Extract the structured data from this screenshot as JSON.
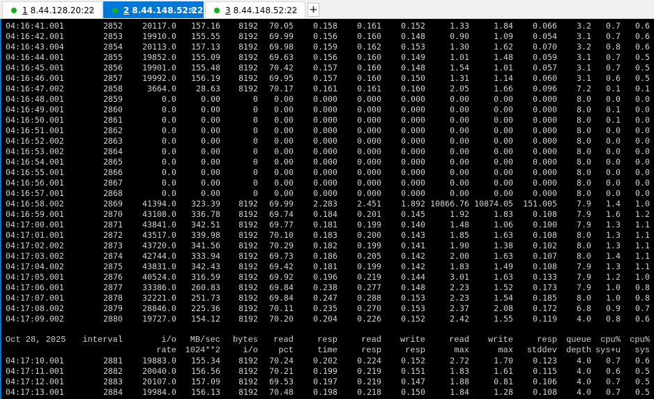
{
  "tabs": [
    {
      "num": "1",
      "label": "8.44.128.20:22",
      "active": false
    },
    {
      "num": "2",
      "label": "8.44.148.52:22",
      "active": true
    },
    {
      "num": "3",
      "label": "8.44.148.52:22",
      "active": false
    }
  ],
  "tab_close": "×",
  "new_tab": "+",
  "header": {
    "line1": [
      "Oct 28, 2025",
      "interval",
      "i/o",
      "MB/sec",
      "bytes",
      "read",
      "resp",
      "read",
      "write",
      "read",
      "write",
      "resp",
      "queue",
      "cpu%",
      "cpu%"
    ],
    "line2": [
      "",
      "",
      "rate",
      "1024**2",
      "i/o",
      "pct",
      "time",
      "resp",
      "resp",
      "max",
      "max",
      "stddev",
      "depth",
      "sys+u",
      "sys"
    ]
  },
  "rows_top": [
    [
      "04:16:41.001",
      "2852",
      "20117.0",
      "157.16",
      "8192",
      "70.05",
      "0.158",
      "0.161",
      "0.152",
      "1.33",
      "1.84",
      "0.066",
      "3.2",
      "0.7",
      "0.6"
    ],
    [
      "04:16:42.001",
      "2853",
      "19910.0",
      "155.55",
      "8192",
      "69.99",
      "0.156",
      "0.160",
      "0.148",
      "0.90",
      "1.09",
      "0.054",
      "3.1",
      "0.7",
      "0.6"
    ],
    [
      "04:16:43.004",
      "2854",
      "20113.0",
      "157.13",
      "8192",
      "69.98",
      "0.159",
      "0.162",
      "0.153",
      "1.30",
      "1.62",
      "0.070",
      "3.2",
      "0.8",
      "0.6"
    ],
    [
      "04:16:44.001",
      "2855",
      "19852.0",
      "155.09",
      "8192",
      "69.63",
      "0.156",
      "0.160",
      "0.149",
      "1.01",
      "1.48",
      "0.059",
      "3.1",
      "0.7",
      "0.5"
    ],
    [
      "04:16:45.001",
      "2856",
      "19901.0",
      "155.48",
      "8192",
      "70.42",
      "0.157",
      "0.160",
      "0.148",
      "1.54",
      "1.01",
      "0.057",
      "3.1",
      "0.7",
      "0.5"
    ],
    [
      "04:16:46.001",
      "2857",
      "19992.0",
      "156.19",
      "8192",
      "69.95",
      "0.157",
      "0.160",
      "0.150",
      "1.31",
      "1.14",
      "0.060",
      "3.1",
      "0.6",
      "0.5"
    ],
    [
      "04:16:47.002",
      "2858",
      "3664.0",
      "28.63",
      "8192",
      "70.17",
      "0.161",
      "0.161",
      "0.160",
      "2.05",
      "1.66",
      "0.096",
      "7.2",
      "0.1",
      "0.1"
    ],
    [
      "04:16:48.001",
      "2859",
      "0.0",
      "0.00",
      "0",
      "0.00",
      "0.000",
      "0.000",
      "0.000",
      "0.00",
      "0.00",
      "0.000",
      "8.0",
      "0.0",
      "0.0"
    ],
    [
      "04:16:49.001",
      "2860",
      "0.0",
      "0.00",
      "0",
      "0.00",
      "0.000",
      "0.000",
      "0.000",
      "0.00",
      "0.00",
      "0.000",
      "8.0",
      "0.1",
      "0.0"
    ],
    [
      "04:16:50.001",
      "2861",
      "0.0",
      "0.00",
      "0",
      "0.00",
      "0.000",
      "0.000",
      "0.000",
      "0.00",
      "0.00",
      "0.000",
      "8.0",
      "0.1",
      "0.0"
    ],
    [
      "04:16:51.001",
      "2862",
      "0.0",
      "0.00",
      "0",
      "0.00",
      "0.000",
      "0.000",
      "0.000",
      "0.00",
      "0.00",
      "0.000",
      "8.0",
      "0.0",
      "0.0"
    ],
    [
      "04:16:52.002",
      "2863",
      "0.0",
      "0.00",
      "0",
      "0.00",
      "0.000",
      "0.000",
      "0.000",
      "0.00",
      "0.00",
      "0.000",
      "8.0",
      "0.0",
      "0.0"
    ],
    [
      "04:16:53.002",
      "2864",
      "0.0",
      "0.00",
      "0",
      "0.00",
      "0.000",
      "0.000",
      "0.000",
      "0.00",
      "0.00",
      "0.000",
      "8.0",
      "0.0",
      "0.0"
    ],
    [
      "04:16:54.001",
      "2865",
      "0.0",
      "0.00",
      "0",
      "0.00",
      "0.000",
      "0.000",
      "0.000",
      "0.00",
      "0.00",
      "0.000",
      "8.0",
      "0.0",
      "0.0"
    ],
    [
      "04:16:55.001",
      "2866",
      "0.0",
      "0.00",
      "0",
      "0.00",
      "0.000",
      "0.000",
      "0.000",
      "0.00",
      "0.00",
      "0.000",
      "8.0",
      "0.0",
      "0.0"
    ],
    [
      "04:16:56.001",
      "2867",
      "0.0",
      "0.00",
      "0",
      "0.00",
      "0.000",
      "0.000",
      "0.000",
      "0.00",
      "0.00",
      "0.000",
      "8.0",
      "0.0",
      "0.0"
    ],
    [
      "04:16:57.001",
      "2868",
      "0.0",
      "0.00",
      "0",
      "0.00",
      "0.000",
      "0.000",
      "0.000",
      "0.00",
      "0.00",
      "0.000",
      "8.0",
      "0.0",
      "0.0"
    ],
    [
      "04:16:58.002",
      "2869",
      "41394.0",
      "323.39",
      "8192",
      "69.99",
      "2.283",
      "2.451",
      "1.892",
      "10866.76",
      "10874.05",
      "151.005",
      "7.9",
      "1.4",
      "1.0"
    ],
    [
      "04:16:59.001",
      "2870",
      "43108.0",
      "336.78",
      "8192",
      "69.74",
      "0.184",
      "0.201",
      "0.145",
      "1.92",
      "1.83",
      "0.108",
      "7.9",
      "1.6",
      "1.2"
    ],
    [
      "04:17:00.001",
      "2871",
      "43841.0",
      "342.51",
      "8192",
      "69.77",
      "0.181",
      "0.199",
      "0.140",
      "1.48",
      "1.06",
      "0.100",
      "7.9",
      "1.3",
      "1.1"
    ],
    [
      "04:17:01.001",
      "2872",
      "43517.0",
      "339.98",
      "8192",
      "70.10",
      "0.183",
      "0.200",
      "0.143",
      "1.85",
      "1.63",
      "0.108",
      "8.0",
      "1.3",
      "1.1"
    ],
    [
      "04:17:02.002",
      "2873",
      "43720.0",
      "341.56",
      "8192",
      "70.29",
      "0.182",
      "0.199",
      "0.141",
      "1.90",
      "1.38",
      "0.102",
      "8.0",
      "1.3",
      "1.1"
    ],
    [
      "04:17:03.002",
      "2874",
      "42744.0",
      "333.94",
      "8192",
      "69.73",
      "0.186",
      "0.205",
      "0.142",
      "2.00",
      "1.63",
      "0.107",
      "8.0",
      "1.4",
      "1.1"
    ],
    [
      "04:17:04.002",
      "2875",
      "43831.0",
      "342.43",
      "8192",
      "69.42",
      "0.181",
      "0.199",
      "0.142",
      "1.83",
      "1.49",
      "0.108",
      "7.9",
      "1.3",
      "1.1"
    ],
    [
      "04:17:05.001",
      "2876",
      "40524.0",
      "316.59",
      "8192",
      "69.92",
      "0.196",
      "0.219",
      "0.144",
      "3.01",
      "1.63",
      "0.133",
      "7.9",
      "1.2",
      "1.0"
    ],
    [
      "04:17:06.001",
      "2877",
      "33386.0",
      "260.83",
      "8192",
      "69.84",
      "0.238",
      "0.277",
      "0.148",
      "2.23",
      "1.52",
      "0.173",
      "7.9",
      "1.0",
      "0.8"
    ],
    [
      "04:17:07.001",
      "2878",
      "32221.0",
      "251.73",
      "8192",
      "69.84",
      "0.247",
      "0.288",
      "0.153",
      "2.23",
      "1.54",
      "0.185",
      "8.0",
      "1.0",
      "0.8"
    ],
    [
      "04:17:08.002",
      "2879",
      "28846.0",
      "225.36",
      "8192",
      "70.11",
      "0.235",
      "0.270",
      "0.153",
      "2.37",
      "2.08",
      "0.172",
      "6.8",
      "0.9",
      "0.7"
    ],
    [
      "04:17:09.002",
      "2880",
      "19727.0",
      "154.12",
      "8192",
      "70.20",
      "0.204",
      "0.226",
      "0.152",
      "2.42",
      "1.55",
      "0.119",
      "4.0",
      "0.8",
      "0.6"
    ]
  ],
  "rows_bottom": [
    [
      "04:17:10.001",
      "2881",
      "19883.0",
      "155.34",
      "8192",
      "70.24",
      "0.202",
      "0.224",
      "0.152",
      "2.72",
      "1.70",
      "0.123",
      "4.0",
      "0.7",
      "0.6"
    ],
    [
      "04:17:11.001",
      "2882",
      "20040.0",
      "156.56",
      "8192",
      "70.21",
      "0.199",
      "0.219",
      "0.151",
      "1.83",
      "1.61",
      "0.115",
      "4.0",
      "0.6",
      "0.5"
    ],
    [
      "04:17:12.001",
      "2883",
      "20107.0",
      "157.09",
      "8192",
      "69.53",
      "0.197",
      "0.219",
      "0.147",
      "1.88",
      "0.81",
      "0.106",
      "4.0",
      "0.7",
      "0.5"
    ],
    [
      "04:17:13.001",
      "2884",
      "19984.0",
      "156.13",
      "8192",
      "70.48",
      "0.198",
      "0.218",
      "0.150",
      "1.84",
      "1.28",
      "0.108",
      "4.0",
      "0.7",
      "0.5"
    ]
  ]
}
